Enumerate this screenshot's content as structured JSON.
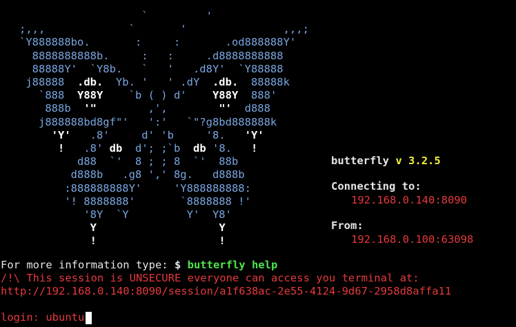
{
  "art": [
    [
      "                      `         '"
    ],
    [
      "   ;,,,             `       '               ,,,;"
    ],
    [
      "   `Y888888bo.       :     :       .od888888Y'"
    ],
    [
      "     8888888888b.     :   :     .d8888888888"
    ],
    [
      "     88888Y'  `Y8b.   `   '   .d8Y'  `Y88888"
    ],
    [
      "    j88888  ",
      "w:.db.",
      "  Yb. '   ' .dY  ",
      "w:.db.",
      "  88888k"
    ],
    [
      "      `888  ",
      "w:Y88Y",
      "    `b ( ) d'    ",
      "w:Y88Y",
      "  888'"
    ],
    [
      "       888b  ",
      "w:'\"",
      "        ,',        ",
      "w:\"'",
      "  d888"
    ],
    [
      "      j888888bd8gf\"'   ':'   `\"?g8bd888888k"
    ],
    [
      "        ",
      "w:'Y'",
      "   .8'     d' 'b     '8.   ",
      "w:'Y'"
    ],
    [
      "         ",
      "w:!",
      "   .8' ",
      "w:db",
      "  d'; ;`b  ",
      "w:db",
      " '8.   ",
      "w:!"
    ],
    [
      "            d88  `'  8 ; ; 8  `'  88b"
    ],
    [
      "           d888b   .g8 ',' 8g.   d888b"
    ],
    [
      "          :888888888Y'     'Y888888888:"
    ],
    [
      "          '! 8888888'       `8888888 !'"
    ],
    [
      "             '8Y  `Y         Y'  Y8'"
    ],
    [
      "              ",
      "w:Y",
      "                   ",
      "w:Y"
    ],
    [
      "              ",
      "w:!",
      "                   ",
      "w:!"
    ]
  ],
  "info": {
    "app_name": "butterfly",
    "version_prefix": "v",
    "version": "3.2.5",
    "connecting_label": "Connecting to:",
    "connecting_value": "192.168.0.140:8090",
    "from_label": "From:",
    "from_value": "192.168.0.100:63098"
  },
  "help": {
    "text": "For more information type: ",
    "prompt": "$ ",
    "command": "butterfly help"
  },
  "warning": {
    "text": "/!\\ This session is UNSECURE everyone can access you terminal at:",
    "url": "http://192.168.0.140:8090/session/a1f638ac-2e55-4124-9d67-2958d8affa11"
  },
  "login": {
    "prompt": "login: ",
    "value": "ubuntu"
  },
  "colors": {
    "background": "#000000",
    "art": "#79a6e0",
    "accent_green": "#4ee44e",
    "accent_yellow": "#f2f034",
    "accent_red": "#e5393d"
  }
}
